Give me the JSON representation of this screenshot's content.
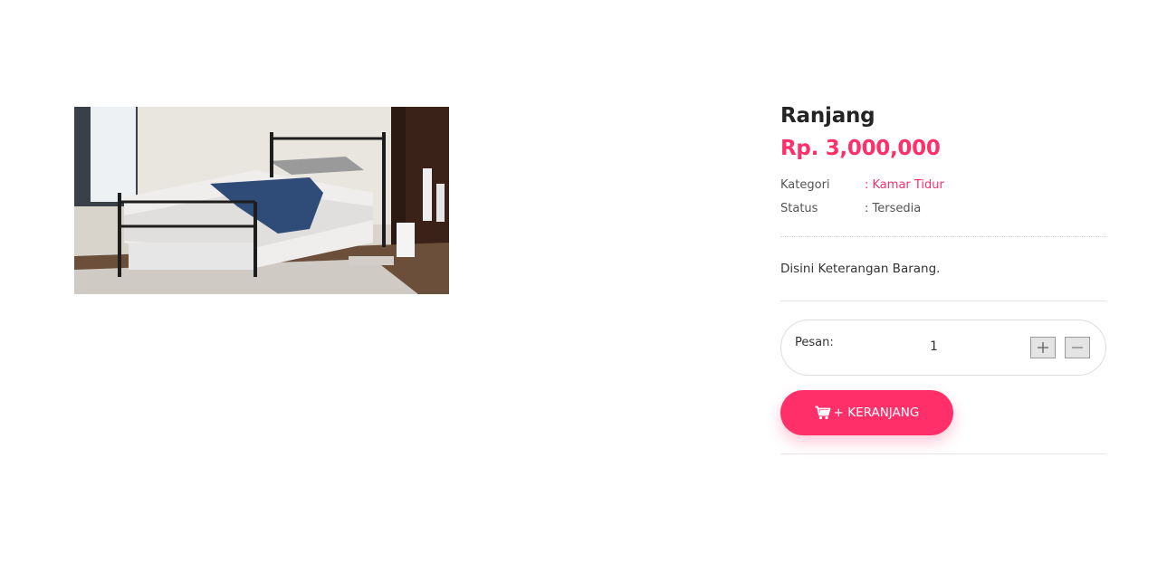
{
  "product": {
    "title": "Ranjang",
    "price": "Rp. 3,000,000",
    "meta": {
      "category_label": "Kategori",
      "category_value": ": Kamar Tidur",
      "status_label": "Status",
      "status_value": ": Tersedia"
    },
    "description": "Disini Keterangan Barang."
  },
  "order": {
    "label": "Pesan:",
    "quantity": "1",
    "plus_label": "+",
    "minus_label": "−",
    "add_to_cart_label": "+ KERANJANG"
  },
  "colors": {
    "accent": "#ff2f6a",
    "text_dark": "#242424",
    "text": "#333333"
  },
  "icons": {
    "cart": "shopping-cart-icon",
    "plus": "plus-icon",
    "minus": "minus-icon"
  }
}
